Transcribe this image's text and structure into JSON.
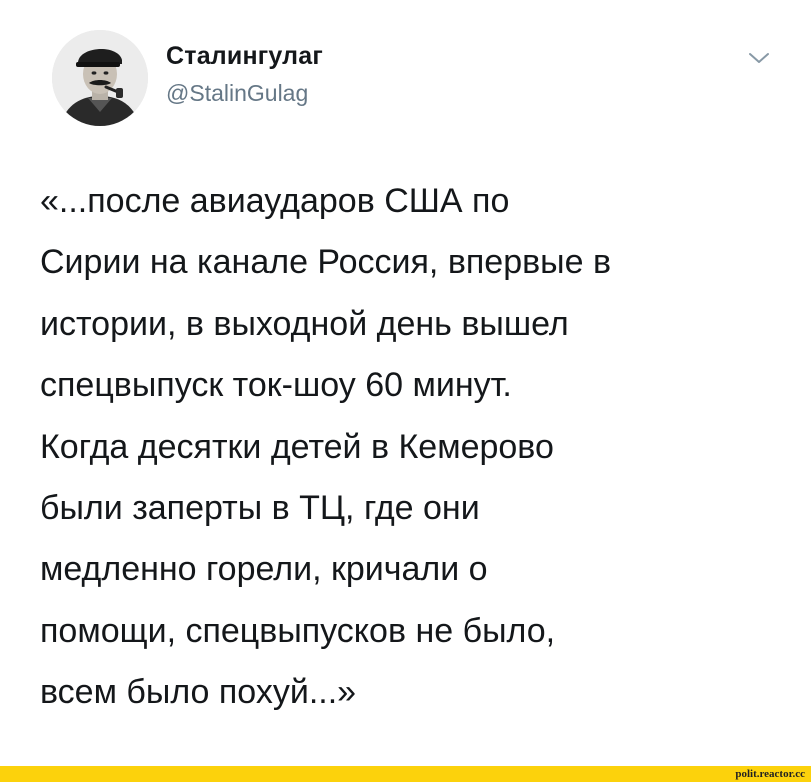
{
  "tweet": {
    "display_name": "Сталингулаг",
    "handle": "@StalinGulag",
    "menu_icon": "chevron-down-icon",
    "avatar_icon": "avatar-portrait",
    "text_lines": [
      "«...после авиаударов США по",
      "Сирии на канале Россия, впервые в",
      "истории, в выходной день вышел",
      "спецвыпуск ток-шоу 60 минут.",
      "Когда десятки детей в Кемерово",
      "были заперты в ТЦ, где они",
      "медленно горели, кричали о",
      "помощи, спецвыпусков не было,",
      "всем было похуй...»"
    ]
  },
  "footer": {
    "watermark": "polit.reactor.cc"
  },
  "colors": {
    "text": "#14171a",
    "handle": "#657786",
    "caret": "#8899a6",
    "footer_bar": "#fcd20c"
  }
}
